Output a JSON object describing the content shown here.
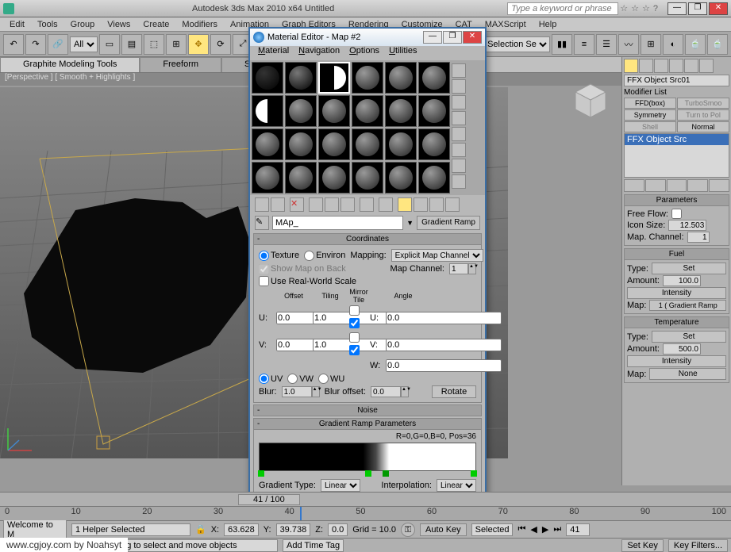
{
  "app": {
    "title": "Autodesk 3ds Max 2010 x64    Untitled",
    "search_placeholder": "Type a keyword or phrase"
  },
  "menu": [
    "Edit",
    "Tools",
    "Group",
    "Views",
    "Create",
    "Modifiers",
    "Animation",
    "Graph Editors",
    "Rendering",
    "Customize",
    "CAT",
    "MAXScript",
    "Help"
  ],
  "toolbar": {
    "filter": "All",
    "right_combo": "Create Selection Se"
  },
  "tabs": {
    "a": "Graphite Modeling Tools",
    "b": "Freeform",
    "c": "Selection"
  },
  "viewport": {
    "label": "[Perspective ] [ Smooth + Highlights ]"
  },
  "material_editor": {
    "title": "Material Editor - Map #2",
    "menu": {
      "m": "Material",
      "n": "Navigation",
      "o": "Options",
      "u": "Utilities"
    },
    "map_name": "MAp_",
    "map_type": "Gradient Ramp",
    "coord": {
      "header": "Coordinates",
      "texture": "Texture",
      "environ": "Environ",
      "mapping_label": "Mapping:",
      "mapping": "Explicit Map Channel",
      "show_map": "Show Map on Back",
      "real_world": "Use Real-World Scale",
      "map_channel_label": "Map Channel:",
      "map_channel": "1",
      "th_offset": "Offset",
      "th_tiling": "Tiling",
      "th_mirror": "Mirror Tile",
      "th_angle": "Angle",
      "u_off": "0.0",
      "u_til": "1.0",
      "u_ang": "0.0",
      "v_off": "0.0",
      "v_til": "1.0",
      "v_ang": "0.0",
      "w_ang": "0.0",
      "uv": "UV",
      "vw": "VW",
      "wu": "WU",
      "blur_label": "Blur:",
      "blur": "1.0",
      "bluroff_label": "Blur offset:",
      "bluroff": "0.0",
      "rotate": "Rotate"
    },
    "noise_header": "Noise",
    "gramp": {
      "header": "Gradient Ramp Parameters",
      "readout": "R=0,G=0,B=0, Pos=36",
      "gtype_label": "Gradient Type:",
      "gtype": "Linear",
      "interp_label": "Interpolation:",
      "interp": "Linear"
    }
  },
  "right": {
    "obj_name": "FFX Object Src01",
    "mod_label": "Modifier List",
    "btns": {
      "ffd": "FFD(box)",
      "turbo": "TurboSmoo",
      "sym": "Symmetry",
      "turnpoly": "Turn to Pol",
      "shell": "Shell",
      "normal": "Normal"
    },
    "stack_item": "FFX Object Src",
    "params_header": "Parameters",
    "freeflow": "Free Flow:",
    "iconsize": "Icon Size:",
    "iconsize_val": "12.503",
    "mapchan": "Map. Channel:",
    "mapchan_val": "1",
    "fuel_header": "Fuel",
    "type": "Type:",
    "set": "Set",
    "amount": "Amount:",
    "amount_val": "100.0",
    "intensity": "Intensity",
    "map_label": "Map:",
    "map_val": "1  ( Gradient Ramp",
    "temp_header": "Temperature",
    "temp_amount": "500.0",
    "temp_int": "Intensity",
    "temp_map": "Map:",
    "temp_none": "None"
  },
  "time": {
    "pos": "41 / 100",
    "frame_now": "40",
    "ticks": [
      "0",
      "10",
      "20",
      "30",
      "40",
      "50",
      "60",
      "70",
      "80",
      "90",
      "100"
    ]
  },
  "status": {
    "sel": "1 Helper Selected",
    "hint": "Click and drag to select and move objects",
    "x": "63.628",
    "y": "39.738",
    "z": "0.0",
    "grid": "Grid = 10.0",
    "autokey": "Auto Key",
    "selected": "Selected",
    "setkey": "Set Key",
    "keyfilters": "Key Filters...",
    "addtag": "Add Time Tag",
    "welcome": "Welcome to M",
    "frame": "41"
  },
  "footer": "www.cgjoy.com by Noahsyt"
}
